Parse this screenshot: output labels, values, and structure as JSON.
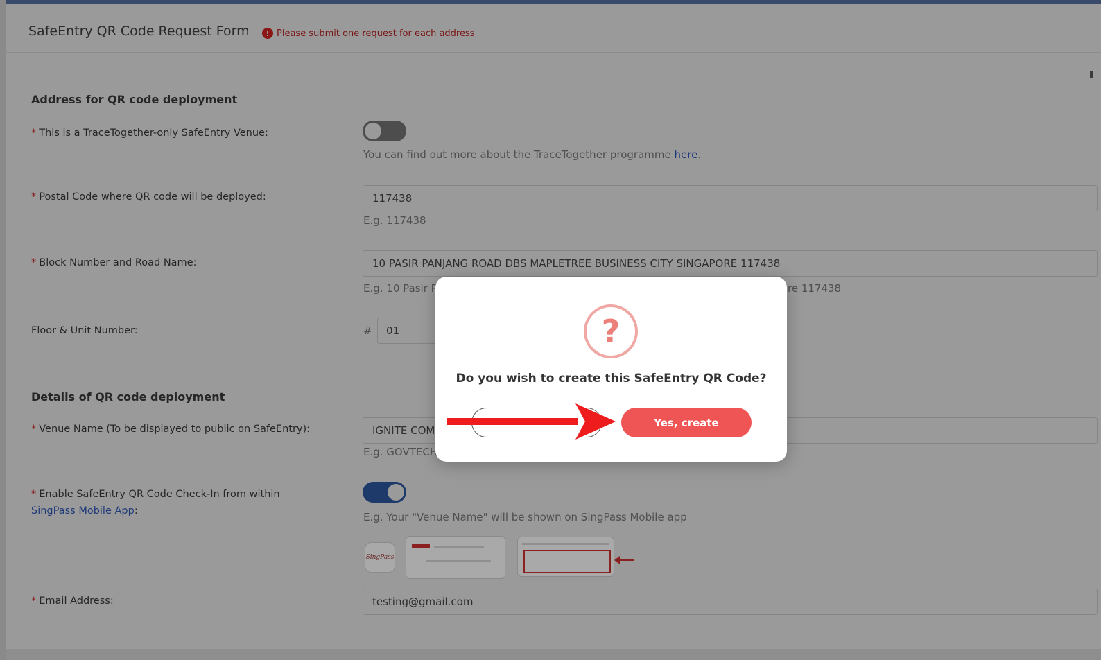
{
  "form": {
    "title": "SafeEntry QR Code Request Form",
    "notice": "Please submit one request for each address",
    "notice_icon": "exclamation-circle-icon"
  },
  "address_section": {
    "title": "Address for QR code deployment",
    "tracetogether": {
      "required_mark": "*",
      "label": "This is a TraceTogether-only SafeEntry Venue:",
      "toggle_on": false,
      "hint_prefix": "You can find out more about the TraceTogether programme ",
      "hint_link": "here",
      "hint_suffix": "."
    },
    "postal_code": {
      "required_mark": "*",
      "label": "Postal Code where QR code will be deployed:",
      "value": "117438",
      "hint": "E.g. 117438"
    },
    "block_road": {
      "required_mark": "*",
      "label": "Block Number and Road Name:",
      "value": "10 PASIR PANJANG ROAD DBS MAPLETREE BUSINESS CITY SINGAPORE 117438",
      "hint_left": "E.g. 10 Pasir Pa",
      "hint_right": "re 117438"
    },
    "floor_unit": {
      "label": "Floor & Unit Number:",
      "prefix": "#",
      "value": "01"
    }
  },
  "details_section": {
    "title": "Details of QR code deployment",
    "venue_name": {
      "required_mark": "*",
      "label": "Venue Name (To be displayed to public on SafeEntry):",
      "value": "IGNITE COM",
      "hint": "E.g. GOVTECH"
    },
    "singpass": {
      "required_mark": "*",
      "label_line1": "Enable SafeEntry QR Code Check-In from within",
      "label_link": "SingPass Mobile App",
      "label_suffix": ":",
      "toggle_on": true,
      "hint": "E.g. Your \"Venue Name\" will be shown on SingPass Mobile app",
      "app_icon_text": "SingPass"
    },
    "email": {
      "required_mark": "*",
      "label": "Email Address:",
      "value": "testing@gmail.com"
    }
  },
  "dialog": {
    "icon": "question-mark-icon",
    "icon_glyph": "?",
    "message": "Do you wish to create this SafeEntry QR Code?",
    "cancel_label": "",
    "confirm_label": "Yes, create"
  },
  "colors": {
    "confirm": "#f05555",
    "annotation_arrow": "#ee1c1c",
    "dialog_icon": "#ec7f79"
  }
}
